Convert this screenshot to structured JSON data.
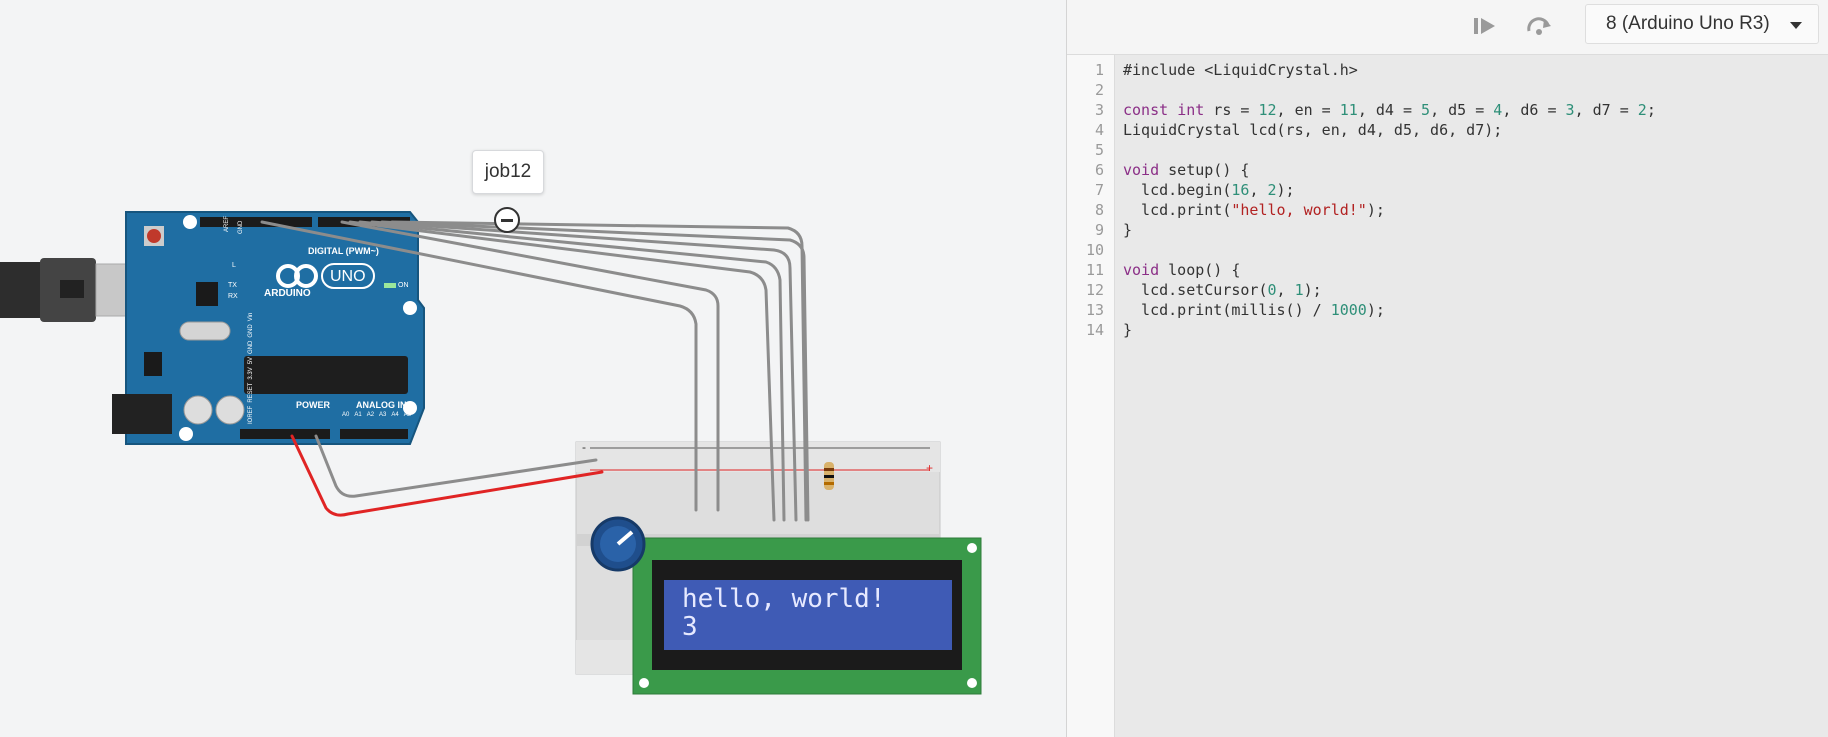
{
  "canvas": {
    "tooltip": "job12",
    "arduino": {
      "brand": "ARDUINO",
      "model": "UNO",
      "digital_label": "DIGITAL (PWM~)",
      "power_label": "POWER",
      "analog_label": "ANALOG IN",
      "on_label": "ON",
      "tx_label": "TX",
      "rx_label": "RX",
      "l_label": "L",
      "aref_label": "AREF",
      "gnd_label": "GND",
      "power_pins": [
        "IOREF",
        "RESET",
        "3.3V",
        "5V",
        "GND",
        "GND",
        "Vin"
      ],
      "analog_pins": [
        "A0",
        "A1",
        "A2",
        "A3",
        "A4",
        "A5"
      ]
    },
    "lcd": {
      "line1": "hello, world!",
      "line2": "3"
    },
    "breadboard": {
      "plus": "+",
      "minus": "-"
    }
  },
  "toolbar": {
    "step_icon": "play-step-icon",
    "stepover_icon": "step-over-icon",
    "device": "8 (Arduino Uno R3)"
  },
  "code": {
    "line_numbers": [
      "1",
      "2",
      "3",
      "4",
      "5",
      "6",
      "7",
      "8",
      "9",
      "10",
      "11",
      "12",
      "13",
      "14"
    ]
  },
  "colors": {
    "arduino_blue": "#1f6ea3",
    "wire_gray": "#8c8c8c",
    "wire_red": "#e02424",
    "lcd_green": "#3a9a4a",
    "lcd_blue": "#3f5bb5",
    "keyword": "#8b2f87",
    "number": "#2e8f78",
    "string": "#b22222"
  }
}
